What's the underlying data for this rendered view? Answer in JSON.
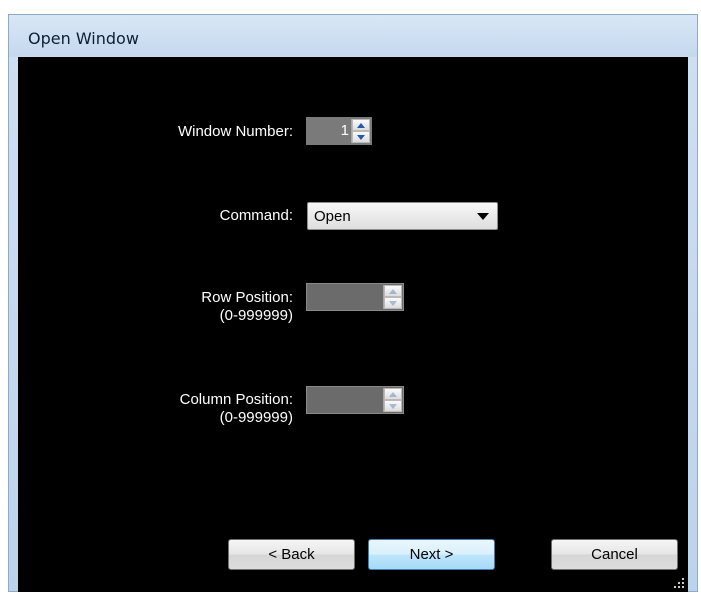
{
  "window": {
    "title": "Open Window"
  },
  "form": {
    "window_number": {
      "label": "Window Number:",
      "value": "1"
    },
    "command": {
      "label": "Command:",
      "selected": "Open"
    },
    "row_position": {
      "label": "Row Position:",
      "range": "(0-999999)",
      "value": ""
    },
    "column_position": {
      "label": "Column Position:",
      "range": "(0-999999)",
      "value": ""
    }
  },
  "buttons": {
    "back": "< Back",
    "next": "Next >",
    "cancel": "Cancel"
  },
  "icons": {
    "spin_up": "chevron-up-icon",
    "spin_down": "chevron-down-icon",
    "dropdown": "dropdown-arrow-icon",
    "resize": "resize-grip-icon"
  },
  "colors": {
    "content_bg": "#000000",
    "label_text": "#ffffff",
    "title_bar": "#c4d8ee"
  }
}
